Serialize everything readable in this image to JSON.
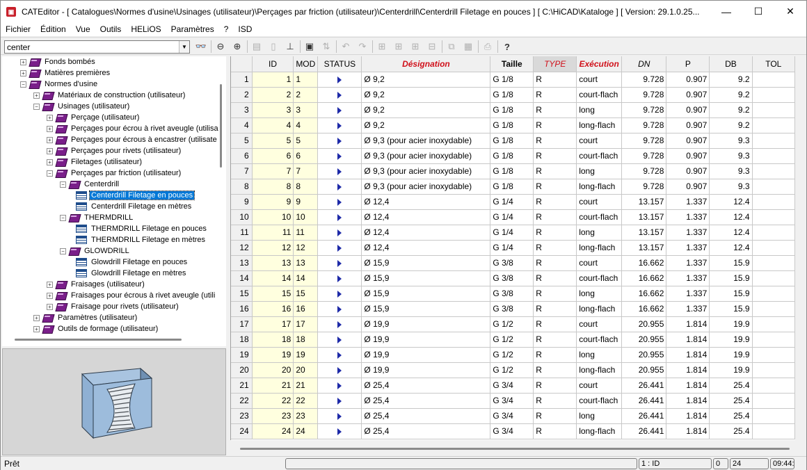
{
  "window": {
    "title": "CATEditor - [ Catalogues\\Normes d'usine\\Usinages (utilisateur)\\Perçages par friction (utilisateur)\\Centerdrill\\Centerdrill Filetage en pouces ]     [ C:\\HiCAD\\Kataloge ]   [ Version: 29.1.0.25...",
    "controls": {
      "minimize": "—",
      "maximize": "☐",
      "close": "✕"
    }
  },
  "menu": [
    "Fichier",
    "Édition",
    "Vue",
    "Outils",
    "HELiOS",
    "Paramètres",
    "?",
    "ISD"
  ],
  "search": {
    "value": "center"
  },
  "tree": [
    {
      "label": "Fonds bombés",
      "level": 0,
      "icon": "book",
      "toggle": "+"
    },
    {
      "label": "Matières premières",
      "level": 0,
      "icon": "book",
      "toggle": "+"
    },
    {
      "label": "Normes d'usine",
      "level": 0,
      "icon": "book",
      "toggle": "−"
    },
    {
      "label": "Matériaux de construction (utilisateur)",
      "level": 1,
      "icon": "book",
      "toggle": "+"
    },
    {
      "label": "Usinages (utilisateur)",
      "level": 1,
      "icon": "book",
      "toggle": "−"
    },
    {
      "label": "Perçage (utilisateur)",
      "level": 2,
      "icon": "book",
      "toggle": "+"
    },
    {
      "label": "Perçages pour écrou à rivet aveugle (utilisa",
      "level": 2,
      "icon": "book",
      "toggle": "+"
    },
    {
      "label": "Perçages pour écrous à encastrer (utilisate",
      "level": 2,
      "icon": "book",
      "toggle": "+"
    },
    {
      "label": "Perçages pour rivets (utilisateur)",
      "level": 2,
      "icon": "book",
      "toggle": "+"
    },
    {
      "label": "Filetages (utilisateur)",
      "level": 2,
      "icon": "book",
      "toggle": "+"
    },
    {
      "label": "Perçages par friction (utilisateur)",
      "level": 2,
      "icon": "book",
      "toggle": "−"
    },
    {
      "label": "Centerdrill",
      "level": 3,
      "icon": "book",
      "toggle": "−"
    },
    {
      "label": "Centerdrill Filetage en pouces",
      "level": 4,
      "icon": "table",
      "toggle": "",
      "selected": true
    },
    {
      "label": "Centerdrill Filetage en mètres",
      "level": 4,
      "icon": "table",
      "toggle": ""
    },
    {
      "label": "THERMDRILL",
      "level": 3,
      "icon": "book",
      "toggle": "−"
    },
    {
      "label": "THERMDRILL Filetage en pouces",
      "level": 4,
      "icon": "table",
      "toggle": ""
    },
    {
      "label": "THERMDRILL Filetage en mètres",
      "level": 4,
      "icon": "table",
      "toggle": ""
    },
    {
      "label": "GLOWDRILL",
      "level": 3,
      "icon": "book",
      "toggle": "−"
    },
    {
      "label": "Glowdrill Filetage en pouces",
      "level": 4,
      "icon": "table",
      "toggle": ""
    },
    {
      "label": "Glowdrill Filetage en mètres",
      "level": 4,
      "icon": "table",
      "toggle": ""
    },
    {
      "label": "Fraisages (utilisateur)",
      "level": 2,
      "icon": "book",
      "toggle": "+"
    },
    {
      "label": "Fraisages pour écrous à rivet aveugle (utili",
      "level": 2,
      "icon": "book",
      "toggle": "+"
    },
    {
      "label": "Fraisage pour rivets (utilisateur)",
      "level": 2,
      "icon": "book",
      "toggle": "+"
    },
    {
      "label": "Paramètres (utilisateur)",
      "level": 1,
      "icon": "book",
      "toggle": "+"
    },
    {
      "label": "Outils de formage (utilisateur)",
      "level": 1,
      "icon": "book",
      "toggle": "+"
    }
  ],
  "grid": {
    "columns": [
      "ID",
      "MOD",
      "STATUS",
      "Désignation",
      "Taille",
      "TYPE",
      "Exécution",
      "DN",
      "P",
      "DB",
      "TOL"
    ],
    "rows": [
      [
        "1",
        "1",
        "",
        "Ø 9,2",
        "G 1/8",
        "R",
        "court",
        "9.728",
        "0.907",
        "9.2",
        ""
      ],
      [
        "2",
        "2",
        "",
        "Ø 9,2",
        "G 1/8",
        "R",
        "court-flach",
        "9.728",
        "0.907",
        "9.2",
        ""
      ],
      [
        "3",
        "3",
        "",
        "Ø 9,2",
        "G 1/8",
        "R",
        "long",
        "9.728",
        "0.907",
        "9.2",
        ""
      ],
      [
        "4",
        "4",
        "",
        "Ø 9,2",
        "G 1/8",
        "R",
        "long-flach",
        "9.728",
        "0.907",
        "9.2",
        ""
      ],
      [
        "5",
        "5",
        "",
        "Ø 9,3 (pour acier inoxydable)",
        "G 1/8",
        "R",
        "court",
        "9.728",
        "0.907",
        "9.3",
        ""
      ],
      [
        "6",
        "6",
        "",
        "Ø 9,3 (pour acier inoxydable)",
        "G 1/8",
        "R",
        "court-flach",
        "9.728",
        "0.907",
        "9.3",
        ""
      ],
      [
        "7",
        "7",
        "",
        "Ø 9,3 (pour acier inoxydable)",
        "G 1/8",
        "R",
        "long",
        "9.728",
        "0.907",
        "9.3",
        ""
      ],
      [
        "8",
        "8",
        "",
        "Ø 9,3 (pour acier inoxydable)",
        "G 1/8",
        "R",
        "long-flach",
        "9.728",
        "0.907",
        "9.3",
        ""
      ],
      [
        "9",
        "9",
        "",
        "Ø 12,4",
        "G 1/4",
        "R",
        "court",
        "13.157",
        "1.337",
        "12.4",
        ""
      ],
      [
        "10",
        "10",
        "",
        "Ø 12,4",
        "G 1/4",
        "R",
        "court-flach",
        "13.157",
        "1.337",
        "12.4",
        ""
      ],
      [
        "11",
        "11",
        "",
        "Ø 12,4",
        "G 1/4",
        "R",
        "long",
        "13.157",
        "1.337",
        "12.4",
        ""
      ],
      [
        "12",
        "12",
        "",
        "Ø 12,4",
        "G 1/4",
        "R",
        "long-flach",
        "13.157",
        "1.337",
        "12.4",
        ""
      ],
      [
        "13",
        "13",
        "",
        "Ø 15,9",
        "G 3/8",
        "R",
        "court",
        "16.662",
        "1.337",
        "15.9",
        ""
      ],
      [
        "14",
        "14",
        "",
        "Ø 15,9",
        "G 3/8",
        "R",
        "court-flach",
        "16.662",
        "1.337",
        "15.9",
        ""
      ],
      [
        "15",
        "15",
        "",
        "Ø 15,9",
        "G 3/8",
        "R",
        "long",
        "16.662",
        "1.337",
        "15.9",
        ""
      ],
      [
        "16",
        "16",
        "",
        "Ø 15,9",
        "G 3/8",
        "R",
        "long-flach",
        "16.662",
        "1.337",
        "15.9",
        ""
      ],
      [
        "17",
        "17",
        "",
        "Ø 19,9",
        "G 1/2",
        "R",
        "court",
        "20.955",
        "1.814",
        "19.9",
        ""
      ],
      [
        "18",
        "18",
        "",
        "Ø 19,9",
        "G 1/2",
        "R",
        "court-flach",
        "20.955",
        "1.814",
        "19.9",
        ""
      ],
      [
        "19",
        "19",
        "",
        "Ø 19,9",
        "G 1/2",
        "R",
        "long",
        "20.955",
        "1.814",
        "19.9",
        ""
      ],
      [
        "20",
        "20",
        "",
        "Ø 19,9",
        "G 1/2",
        "R",
        "long-flach",
        "20.955",
        "1.814",
        "19.9",
        ""
      ],
      [
        "21",
        "21",
        "",
        "Ø 25,4",
        "G 3/4",
        "R",
        "court",
        "26.441",
        "1.814",
        "25.4",
        ""
      ],
      [
        "22",
        "22",
        "",
        "Ø 25,4",
        "G 3/4",
        "R",
        "court-flach",
        "26.441",
        "1.814",
        "25.4",
        ""
      ],
      [
        "23",
        "23",
        "",
        "Ø 25,4",
        "G 3/4",
        "R",
        "long",
        "26.441",
        "1.814",
        "25.4",
        ""
      ],
      [
        "24",
        "24",
        "",
        "Ø 25,4",
        "G 3/4",
        "R",
        "long-flach",
        "26.441",
        "1.814",
        "25.4",
        ""
      ]
    ]
  },
  "status": {
    "text": "Prêt",
    "panels": [
      "1 : ID",
      "0",
      "24",
      "09:44:"
    ]
  },
  "colors": {
    "accent": "#0078d7",
    "id_column": "#ffffdf",
    "header_red": "#d0101a",
    "status_arrow": "#1e2aa8",
    "book_icon": "#7a1f8a"
  }
}
